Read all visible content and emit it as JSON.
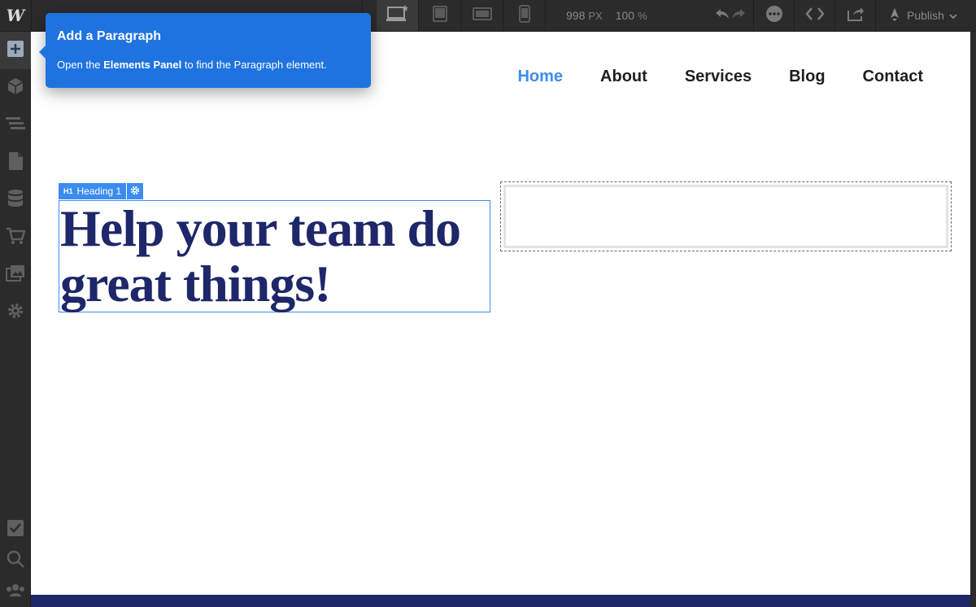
{
  "app": {
    "logo_letter": "W",
    "accent_color": "#3c8cf0",
    "heading_color": "#1e2769"
  },
  "toolbar": {
    "devices": [
      {
        "icon": "desktop-star-icon",
        "active": true
      },
      {
        "icon": "tablet-landscape-icon",
        "active": false
      },
      {
        "icon": "tablet-icon",
        "active": false
      },
      {
        "icon": "phone-icon",
        "active": false
      }
    ],
    "width_value": "998",
    "width_unit": "PX",
    "zoom_value": "100",
    "zoom_unit": "%",
    "publish_label": "Publish"
  },
  "sidebar": {
    "top_icons": [
      "add-icon",
      "cube-icon",
      "navigator-icon",
      "pages-icon",
      "database-icon",
      "cart-icon",
      "assets-icon",
      "settings-icon"
    ],
    "bottom_icons": [
      "checklist-icon",
      "search-icon",
      "users-icon"
    ]
  },
  "tooltip": {
    "title": "Add a Paragraph",
    "body_prefix": "Open the ",
    "body_bold": "Elements Panel",
    "body_suffix": " to find the Paragraph element."
  },
  "nav": {
    "items": [
      {
        "label": "Home",
        "active": true
      },
      {
        "label": "About",
        "active": false
      },
      {
        "label": "Services",
        "active": false
      },
      {
        "label": "Blog",
        "active": false
      },
      {
        "label": "Contact",
        "active": false
      }
    ]
  },
  "selection": {
    "tag": "H1",
    "label": "Heading 1"
  },
  "hero": {
    "line1": "Help your team do",
    "line2": "great things!"
  }
}
